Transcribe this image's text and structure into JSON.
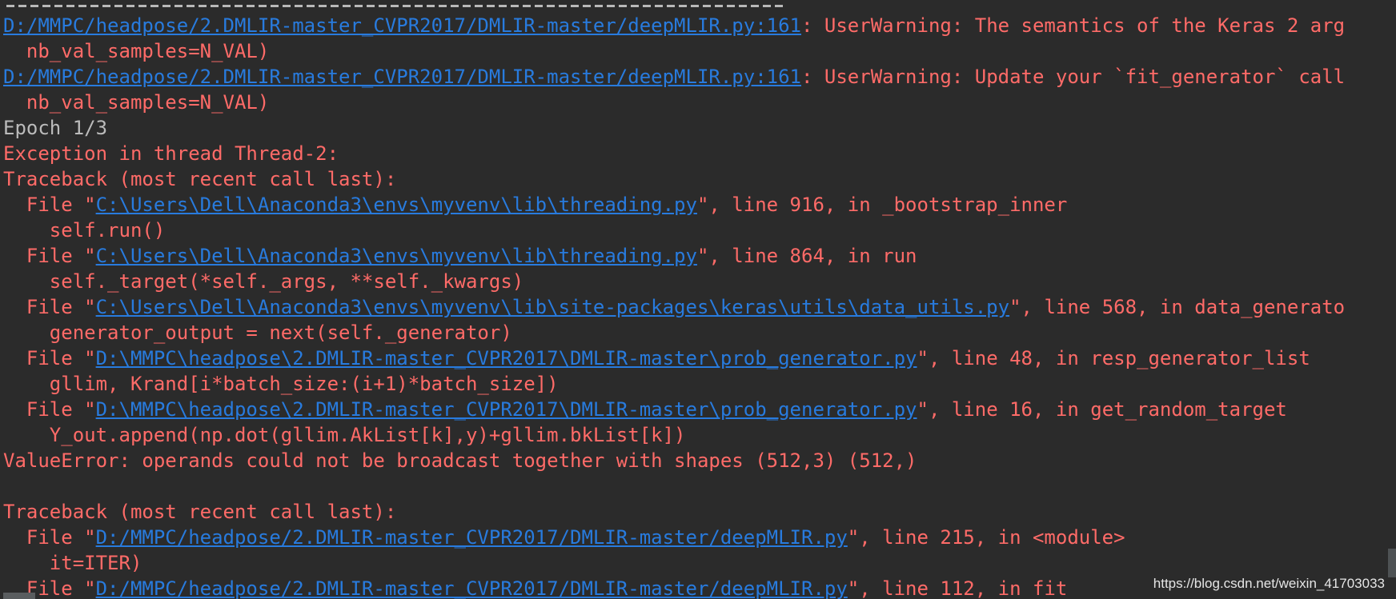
{
  "console": {
    "lines": [
      {
        "kind": "warning",
        "link": "D:/MMPC/headpose/2.DMLIR-master_CVPR2017/DMLIR-master/deepMLIR.py:161",
        "rest": ": UserWarning: The semantics of the Keras 2 arg"
      },
      {
        "kind": "error",
        "text": "  nb_val_samples=N_VAL)"
      },
      {
        "kind": "warning",
        "link": "D:/MMPC/headpose/2.DMLIR-master_CVPR2017/DMLIR-master/deepMLIR.py:161",
        "rest": ": UserWarning: Update your `fit_generator` call"
      },
      {
        "kind": "error",
        "text": "  nb_val_samples=N_VAL)"
      },
      {
        "kind": "plain",
        "text": "Epoch 1/3"
      },
      {
        "kind": "error",
        "text": "Exception in thread Thread-2:"
      },
      {
        "kind": "error",
        "text": "Traceback (most recent call last):"
      },
      {
        "kind": "file",
        "pre": "  File \"",
        "link": "C:\\Users\\Dell\\Anaconda3\\envs\\myvenv\\lib\\threading.py",
        "post": "\", line 916, in _bootstrap_inner"
      },
      {
        "kind": "error",
        "text": "    self.run()"
      },
      {
        "kind": "file",
        "pre": "  File \"",
        "link": "C:\\Users\\Dell\\Anaconda3\\envs\\myvenv\\lib\\threading.py",
        "post": "\", line 864, in run"
      },
      {
        "kind": "error",
        "text": "    self._target(*self._args, **self._kwargs)"
      },
      {
        "kind": "file",
        "pre": "  File \"",
        "link": "C:\\Users\\Dell\\Anaconda3\\envs\\myvenv\\lib\\site-packages\\keras\\utils\\data_utils.py",
        "post": "\", line 568, in data_generato"
      },
      {
        "kind": "error",
        "text": "    generator_output = next(self._generator)"
      },
      {
        "kind": "file",
        "pre": "  File \"",
        "link": "D:\\MMPC\\headpose\\2.DMLIR-master_CVPR2017\\DMLIR-master\\prob_generator.py",
        "post": "\", line 48, in resp_generator_list"
      },
      {
        "kind": "error",
        "text": "    gllim, Krand[i*batch_size:(i+1)*batch_size])"
      },
      {
        "kind": "file",
        "pre": "  File \"",
        "link": "D:\\MMPC\\headpose\\2.DMLIR-master_CVPR2017\\DMLIR-master\\prob_generator.py",
        "post": "\", line 16, in get_random_target"
      },
      {
        "kind": "error",
        "text": "    Y_out.append(np.dot(gllim.AkList[k],y)+gllim.bkList[k])"
      },
      {
        "kind": "error",
        "text": "ValueError: operands could not be broadcast together with shapes (512,3) (512,)"
      },
      {
        "kind": "error",
        "text": ""
      },
      {
        "kind": "error",
        "text": "Traceback (most recent call last):"
      },
      {
        "kind": "file",
        "pre": "  File \"",
        "link": "D:/MMPC/headpose/2.DMLIR-master_CVPR2017/DMLIR-master/deepMLIR.py",
        "post": "\", line 215, in <module>"
      },
      {
        "kind": "error",
        "text": "    it=ITER)"
      },
      {
        "kind": "file",
        "pre": "  File \"",
        "link": "D:/MMPC/headpose/2.DMLIR-master_CVPR2017/DMLIR-master/deepMLIR.py",
        "post": "\", line 112, in fit"
      }
    ]
  },
  "watermark": "https://blog.csdn.net/weixin_41703033",
  "colors": {
    "background": "#2b2b2b",
    "error_text": "#ff6b68",
    "plain_text": "#bbbbbb",
    "link_text": "#287bde"
  }
}
